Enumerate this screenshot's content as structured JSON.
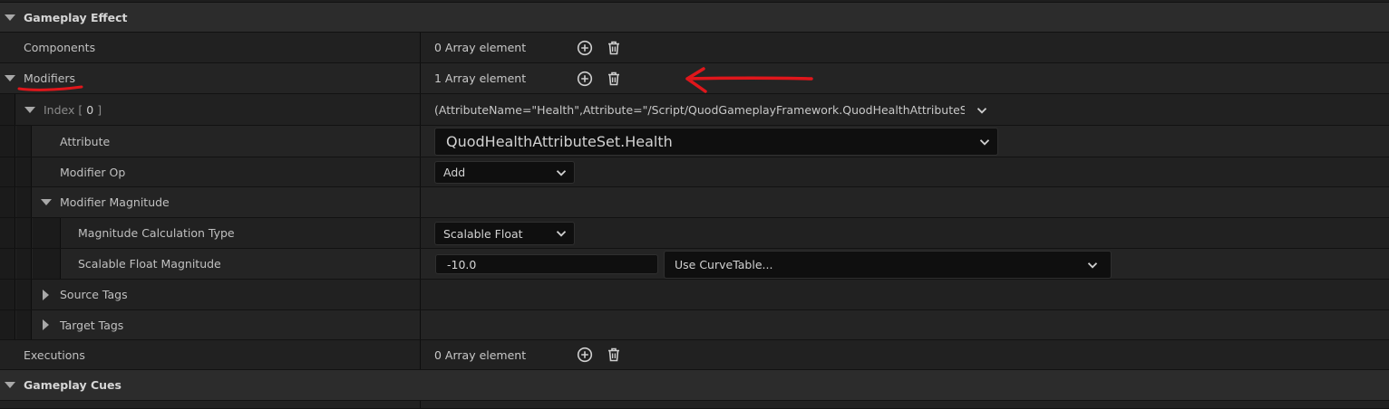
{
  "categories": {
    "gameplay_effect": "Gameplay Effect",
    "gameplay_cues": "Gameplay Cues"
  },
  "components": {
    "label": "Components",
    "value": "0 Array element"
  },
  "modifiers": {
    "label": "Modifiers",
    "value": "1 Array element"
  },
  "index": {
    "label": "Index",
    "bracket_open": "[",
    "number": "0",
    "bracket_close": "]",
    "value": "(AttributeName=\"Health\",Attribute=\"/Script/QuodGameplayFramework.QuodHealthAttributeSet:Healt"
  },
  "attribute": {
    "label": "Attribute",
    "value": "QuodHealthAttributeSet.Health"
  },
  "modifier_op": {
    "label": "Modifier Op",
    "value": "Add"
  },
  "modifier_magnitude": {
    "label": "Modifier Magnitude"
  },
  "magnitude_calc_type": {
    "label": "Magnitude Calculation Type",
    "value": "Scalable Float"
  },
  "scalable_float_magnitude": {
    "label": "Scalable Float Magnitude",
    "value": "-10.0",
    "curve_table": "Use CurveTable..."
  },
  "source_tags": {
    "label": "Source Tags"
  },
  "target_tags": {
    "label": "Target Tags"
  },
  "executions": {
    "label": "Executions",
    "value": "0 Array element"
  },
  "icons": {
    "add": "add-circle-icon",
    "delete": "trash-icon",
    "dropdown": "chevron-down-icon",
    "expanded": "triangle-down-icon",
    "collapsed": "triangle-right-icon"
  },
  "annotation": {
    "color": "#e0161b"
  }
}
